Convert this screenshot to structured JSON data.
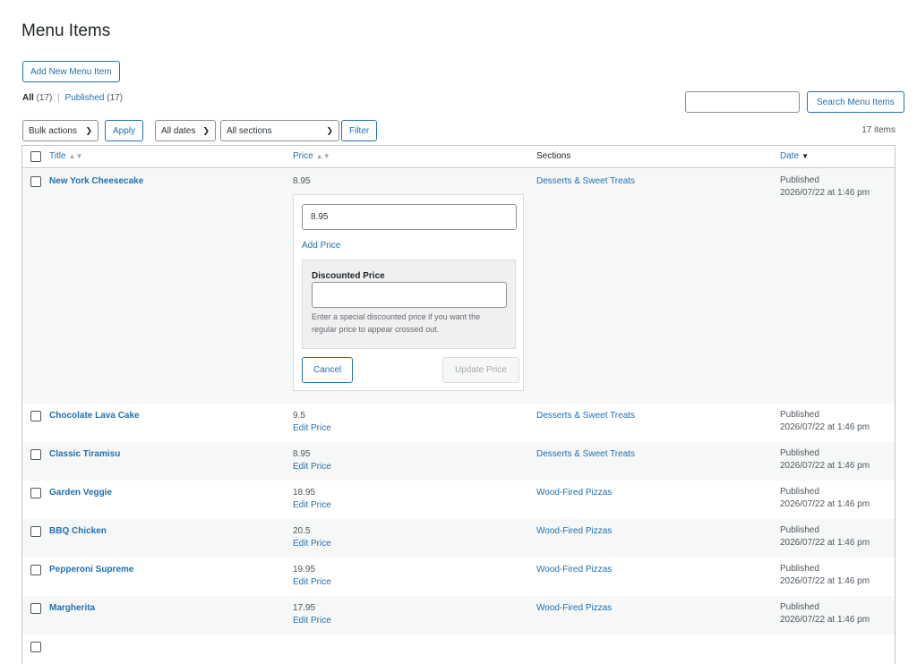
{
  "page": {
    "title": "Menu Items",
    "add_new_label": "Add New Menu Item"
  },
  "views": {
    "all_label": "All",
    "all_count": "(17)",
    "separator": "|",
    "published_label": "Published",
    "published_count": "(17)"
  },
  "search": {
    "value": "",
    "button_label": "Search Menu Items"
  },
  "filters": {
    "bulk_actions": "Bulk actions",
    "apply_label": "Apply",
    "dates": "All dates",
    "sections": "All sections",
    "filter_label": "Filter",
    "items_count": "17 items"
  },
  "columns": {
    "title": "Title",
    "price": "Price",
    "sections": "Sections",
    "date": "Date"
  },
  "editor": {
    "price_value": "8.95",
    "add_price_label": "Add Price",
    "discount_label": "Discounted Price",
    "discount_value": "",
    "discount_help": "Enter a special discounted price if you want the regular price to appear crossed out.",
    "cancel_label": "Cancel",
    "update_label": "Update Price"
  },
  "rows": [
    {
      "title": "New York Cheesecake",
      "price": "8.95",
      "edit_label": "",
      "section": "Desserts & Sweet Treats",
      "status": "Published",
      "date": "2026/07/22 at 1:46 pm"
    },
    {
      "title": "Chocolate Lava Cake",
      "price": "9.5",
      "edit_label": "Edit Price",
      "section": "Desserts & Sweet Treats",
      "status": "Published",
      "date": "2026/07/22 at 1:46 pm"
    },
    {
      "title": "Classic Tiramisu",
      "price": "8.95",
      "edit_label": "Edit Price",
      "section": "Desserts & Sweet Treats",
      "status": "Published",
      "date": "2026/07/22 at 1:46 pm"
    },
    {
      "title": "Garden Veggie",
      "price": "18.95",
      "edit_label": "Edit Price",
      "section": "Wood-Fired Pizzas",
      "status": "Published",
      "date": "2026/07/22 at 1:46 pm"
    },
    {
      "title": "BBQ Chicken",
      "price": "20.5",
      "edit_label": "Edit Price",
      "section": "Wood-Fired Pizzas",
      "status": "Published",
      "date": "2026/07/22 at 1:46 pm"
    },
    {
      "title": "Pepperoni Supreme",
      "price": "19.95",
      "edit_label": "Edit Price",
      "section": "Wood-Fired Pizzas",
      "status": "Published",
      "date": "2026/07/22 at 1:46 pm"
    },
    {
      "title": "Margherita",
      "price": "17.95",
      "edit_label": "Edit Price",
      "section": "Wood-Fired Pizzas",
      "status": "Published",
      "date": "2026/07/22 at 1:46 pm"
    }
  ]
}
